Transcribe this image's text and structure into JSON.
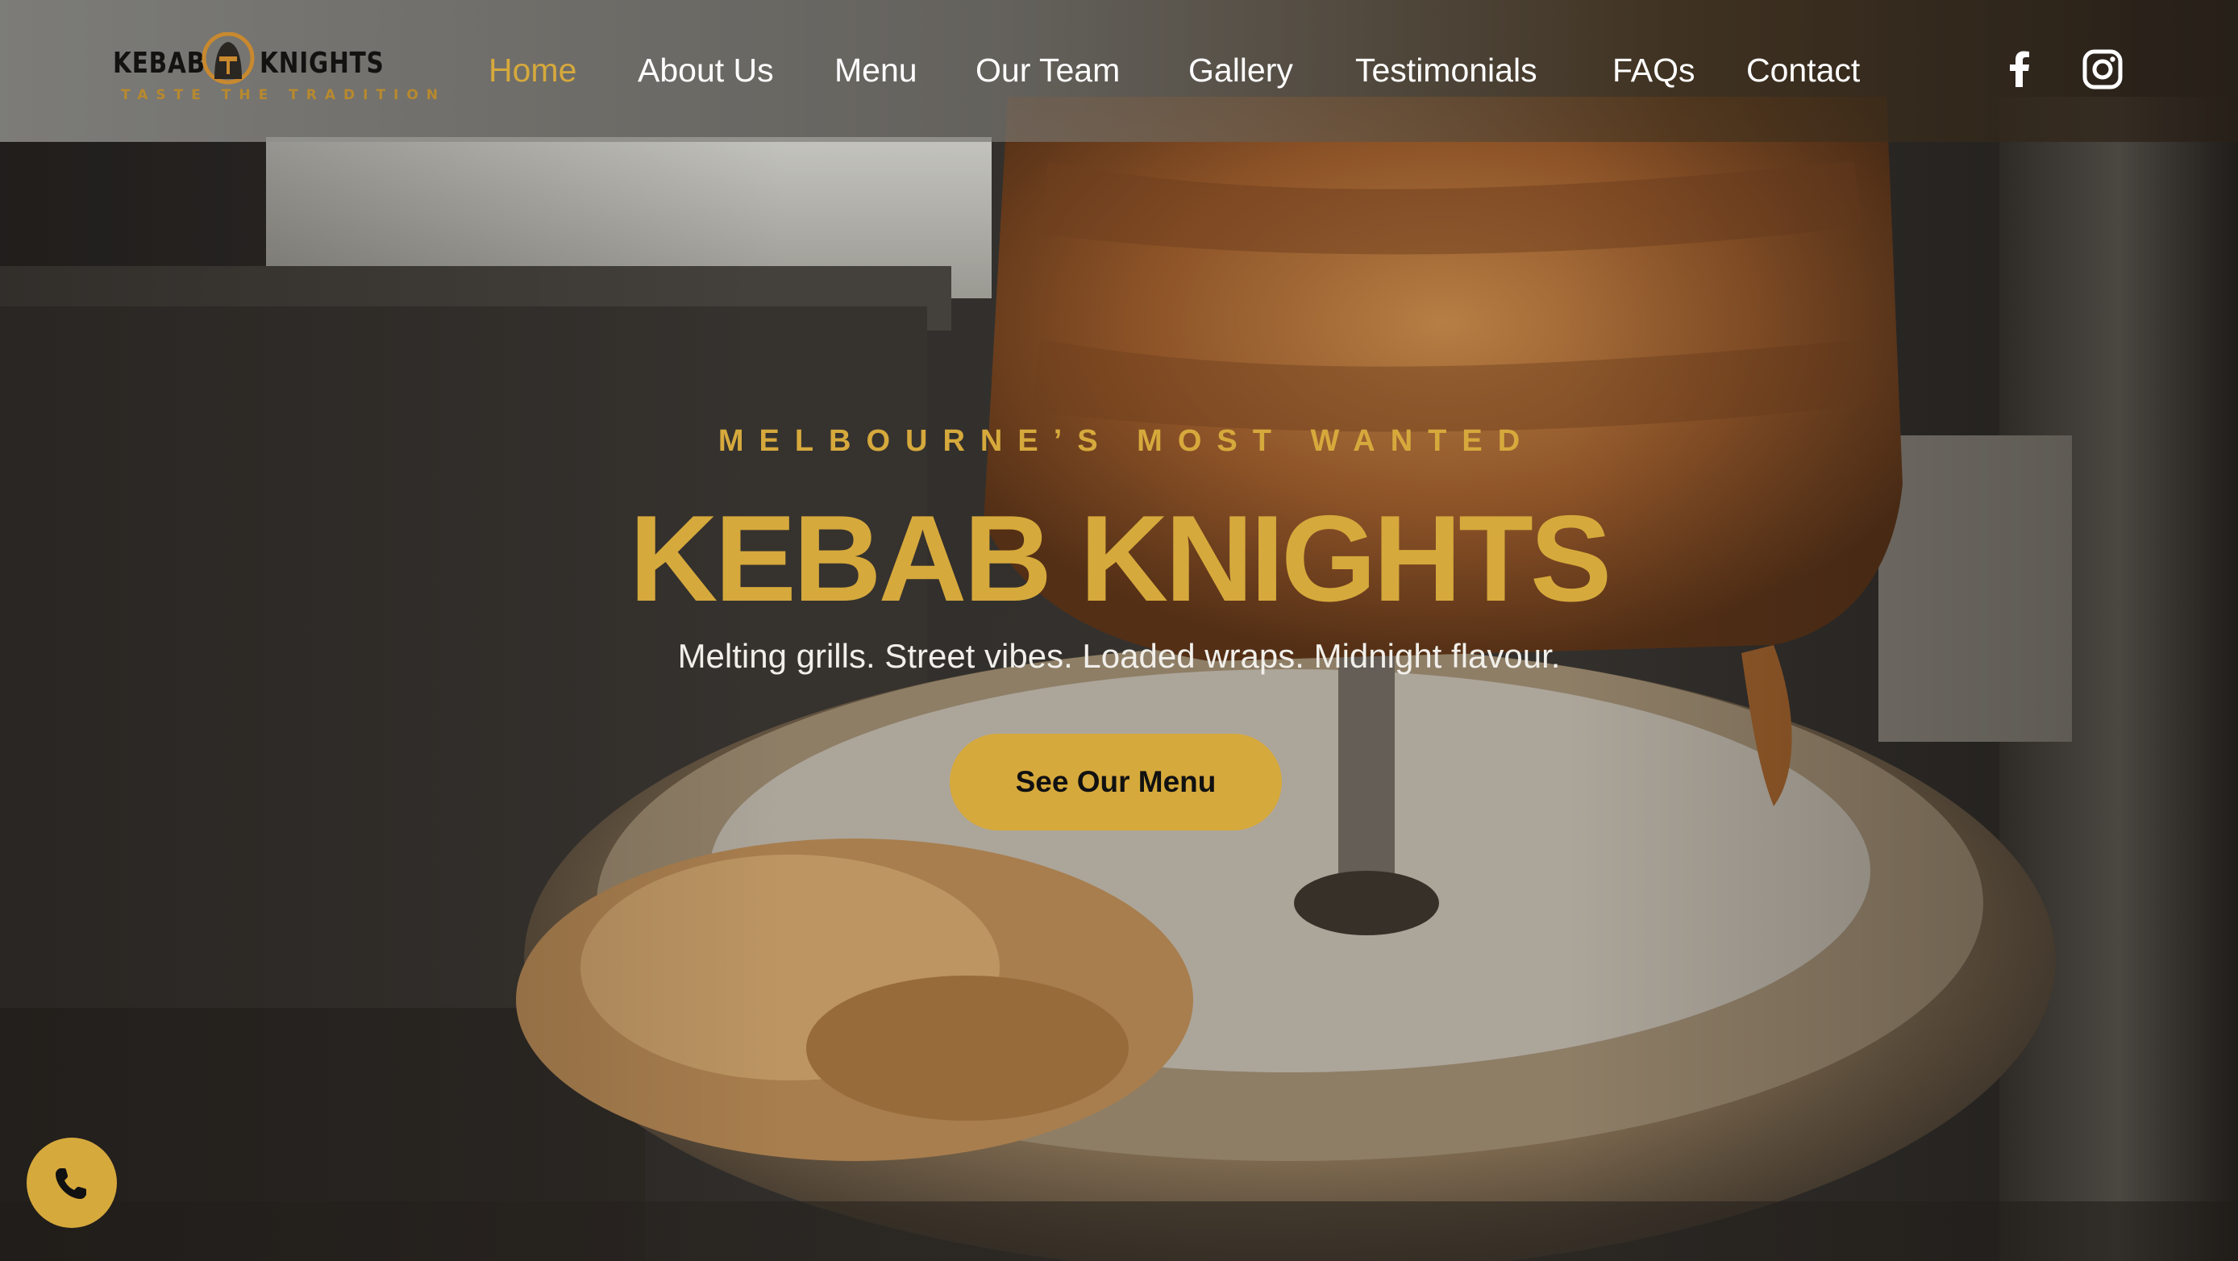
{
  "brand": {
    "word_left": "KEBAB",
    "word_right": "KNIGHTS",
    "tagline": "TASTE THE TRADITION",
    "emblem_icon": "knight-helmet-icon"
  },
  "nav": {
    "items": [
      {
        "label": "Home",
        "active": true
      },
      {
        "label": "About Us",
        "active": false
      },
      {
        "label": "Menu",
        "active": false
      },
      {
        "label": "Our Team",
        "active": false
      },
      {
        "label": "Gallery",
        "active": false
      },
      {
        "label": "Testimonials",
        "active": false
      },
      {
        "label": "FAQs",
        "active": false
      },
      {
        "label": "Contact",
        "active": false
      }
    ]
  },
  "social": {
    "icons": [
      "facebook-icon",
      "instagram-icon"
    ]
  },
  "hero": {
    "eyebrow": "MELBOURNE’S MOST WANTED",
    "title": "KEBAB KNIGHTS",
    "subtitle": "Melting grills. Street vibes. Loaded wraps. Midnight flavour.",
    "cta_label": "See Our Menu",
    "background_icon": "kebab-rotisserie-photo"
  },
  "floating": {
    "call_icon": "phone-icon"
  },
  "colors": {
    "accent": "#d6a93c",
    "text_light": "#ffffff",
    "button_text": "#111111"
  }
}
